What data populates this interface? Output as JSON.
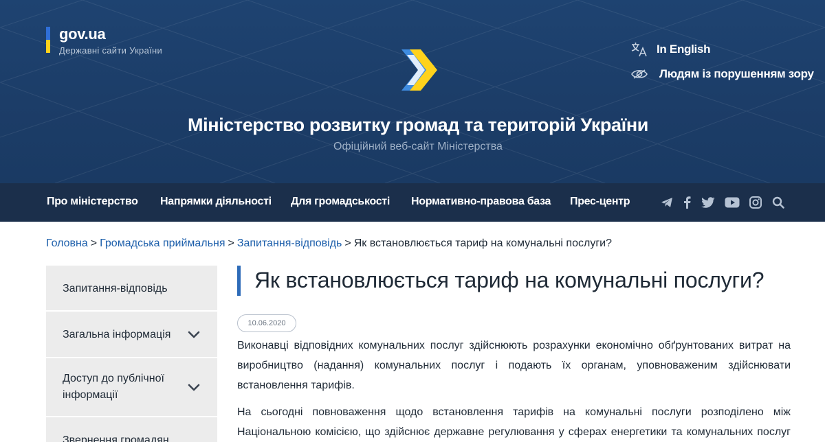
{
  "header": {
    "govua_title": "gov.ua",
    "govua_subtitle": "Державні сайти України",
    "lang_label": "In English",
    "vision_label": "Людям із порушенням зору",
    "site_title": "Міністерство розвитку громад та територій України",
    "site_subtitle": "Офіційний веб-сайт Міністерства",
    "icons": [
      "translate-icon",
      "eye-icon",
      "ministry-logo"
    ],
    "colors": {
      "header_bg": "#1e4371",
      "nav_bg": "#1b2f4b",
      "accent": "#2d6bb8",
      "flag_blue": "#2f6fd8",
      "flag_yellow": "#ffd21c"
    }
  },
  "nav": {
    "items": [
      {
        "label": "Про міністерство"
      },
      {
        "label": "Напрямки діяльності"
      },
      {
        "label": "Для громадськості"
      },
      {
        "label": "Нормативно-правова база"
      },
      {
        "label": "Прес-центр"
      }
    ],
    "social": [
      "telegram-icon",
      "facebook-icon",
      "twitter-icon",
      "youtube-icon",
      "instagram-icon",
      "search-icon"
    ]
  },
  "breadcrumb": {
    "items": [
      {
        "label": "Головна"
      },
      {
        "label": "Громадська приймальня"
      },
      {
        "label": "Запитання-відповідь"
      }
    ],
    "current": "Як встановлюється тариф на комунальні послуги?",
    "separator": ">"
  },
  "sidebar": {
    "items": [
      {
        "label": "Запитання-відповідь"
      },
      {
        "label": "Загальна інформація"
      },
      {
        "label": "Доступ до публічної інформації"
      },
      {
        "label": "Звернення громадян"
      }
    ]
  },
  "article": {
    "title": "Як встановлюється тариф на комунальні послуги?",
    "date": "10.06.2020",
    "paragraphs": [
      "Виконавці відповідних комунальних послуг здійснюють розрахунки економічно обґрунтованих витрат на виробництво (надання) комунальних послуг і подають їх органам, уповноваженим здійснювати встановлення тарифів.",
      "На сьогодні повноваження щодо встановлення тарифів на комунальні послуги розподілено між Національною комісією, що здійснює державне регулювання у сферах енергетики та комунальних послуг (НКРЕКП), та органами місцевого самоврядування."
    ]
  }
}
